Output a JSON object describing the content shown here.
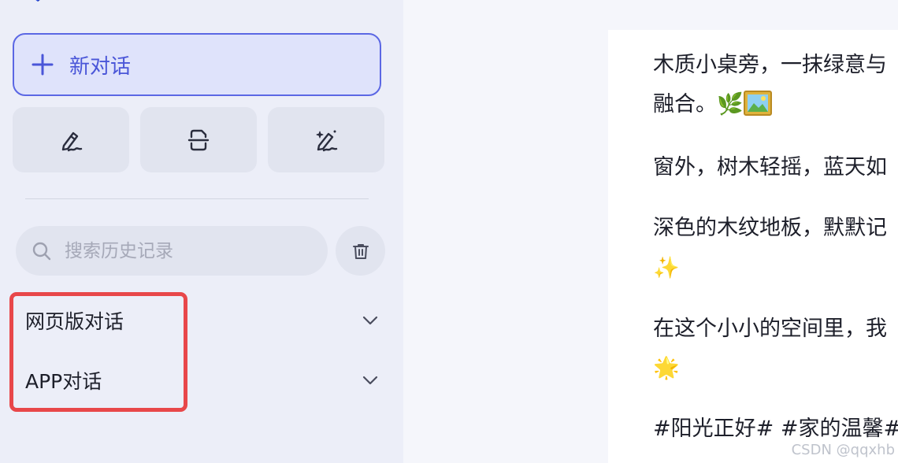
{
  "sidebar": {
    "new_chat_label": "新对话",
    "search_placeholder": "搜索历史记录",
    "groups": [
      {
        "label": "网页版对话"
      },
      {
        "label": "APP对话"
      }
    ],
    "icons": {
      "logo": "cube-logo-icon",
      "plus": "plus-icon",
      "tool_1": "pen-write-icon",
      "tool_2": "document-scan-icon",
      "tool_3": "magic-pen-icon",
      "search": "search-icon",
      "trash": "trash-icon",
      "chevron": "chevron-down-icon"
    }
  },
  "content": {
    "lines": [
      "木质小桌旁，一抹绿意与",
      "融合。",
      "窗外，树木轻摇，蓝天如",
      "深色的木纹地板，默默记",
      "",
      "在这个小小的空间里，我",
      "",
      "#阳光正好# #家的温馨#"
    ],
    "emojis": {
      "herb": "🌿",
      "picture": "picture-icon",
      "sparkles": "✨",
      "glowing_star": "🌟"
    }
  },
  "watermark": "CSDN @qqxhb",
  "colors": {
    "accent": "#5b67e4",
    "highlight": "#e8474a",
    "sidebar_bg": "#eceef8"
  }
}
